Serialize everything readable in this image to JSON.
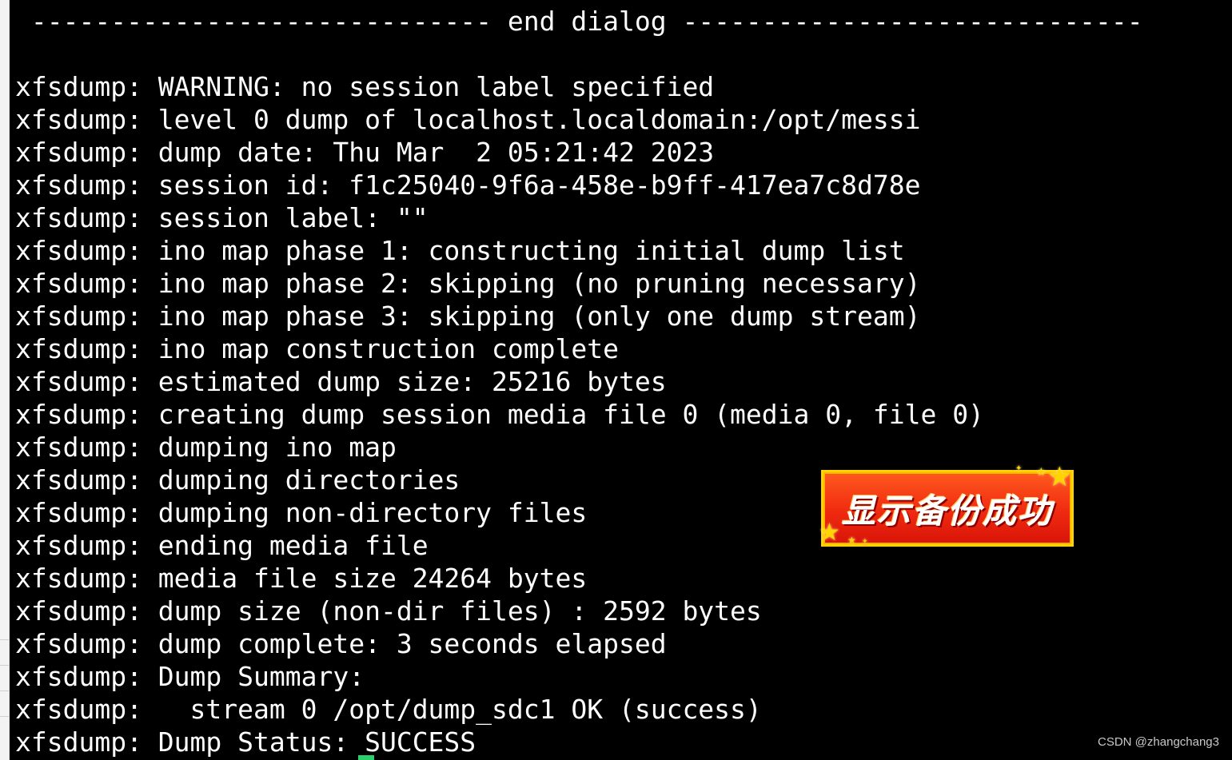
{
  "terminal": {
    "lines": [
      " ----------------------------- end dialog -----------------------------",
      "",
      "xfsdump: WARNING: no session label specified",
      "xfsdump: level 0 dump of localhost.localdomain:/opt/messi",
      "xfsdump: dump date: Thu Mar  2 05:21:42 2023",
      "xfsdump: session id: f1c25040-9f6a-458e-b9ff-417ea7c8d78e",
      "xfsdump: session label: \"\"",
      "xfsdump: ino map phase 1: constructing initial dump list",
      "xfsdump: ino map phase 2: skipping (no pruning necessary)",
      "xfsdump: ino map phase 3: skipping (only one dump stream)",
      "xfsdump: ino map construction complete",
      "xfsdump: estimated dump size: 25216 bytes",
      "xfsdump: creating dump session media file 0 (media 0, file 0)",
      "xfsdump: dumping ino map",
      "xfsdump: dumping directories",
      "xfsdump: dumping non-directory files",
      "xfsdump: ending media file",
      "xfsdump: media file size 24264 bytes",
      "xfsdump: dump size (non-dir files) : 2592 bytes",
      "xfsdump: dump complete: 3 seconds elapsed",
      "xfsdump: Dump Summary:",
      "xfsdump:   stream 0 /opt/dump_sdc1 OK (success)",
      "xfsdump: Dump Status: SUCCESS"
    ]
  },
  "overlay": {
    "banner_text": "显示备份成功"
  },
  "watermark": {
    "text": "CSDN @zhangchang3"
  },
  "colors": {
    "terminal_bg": "#000000",
    "terminal_fg": "#ffffff",
    "banner_bg": "#f02a10",
    "banner_border": "#ffd200"
  }
}
